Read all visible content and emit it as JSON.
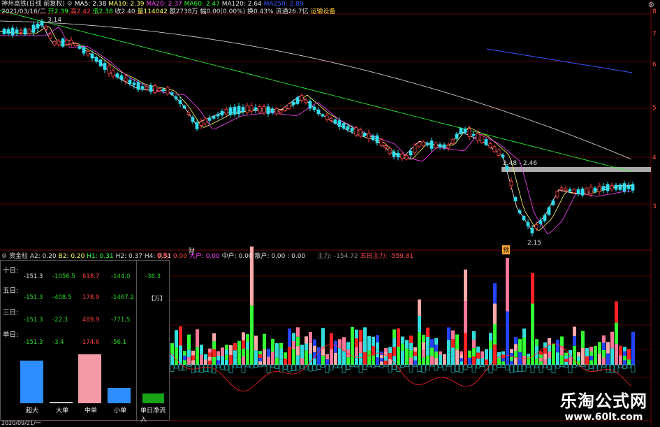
{
  "header": {
    "stock": "神州高铁(日线 前复权)",
    "ma5": "MA5: 2.38",
    "ma10": "MA10: 2.39",
    "ma20": "MA20: 2.37",
    "ma60": "MA60: 2.47",
    "ma120": "MA120: 2.64",
    "ma250": "MA250: 2.89",
    "date": "2021/03/16/二",
    "open": "开2.39",
    "high": "高2.42",
    "low": "低2.38",
    "close": "收2.40",
    "volume": "量114042",
    "amount": "额2738万",
    "change": "幅0.00(0.00%)",
    "turnover": "换0.43%",
    "float_cap": "流通26.7亿",
    "sector": "运输设备",
    "colors": {
      "ma5": "#ffffff",
      "ma10": "#ffff66",
      "ma20": "#ff44ff",
      "ma60": "#33ff33",
      "ma120": "#e0e0e0",
      "ma250": "#3a56ff"
    }
  },
  "main_chart": {
    "high_label": "3.14",
    "low_label": "2.15",
    "range_label": "2.48 - 2.46",
    "marker_cai": "财",
    "marker_yu": "预",
    "y_ticks": [
      "3",
      "4",
      "5",
      "6",
      "7",
      "8"
    ]
  },
  "indicator": {
    "name": "资金柱",
    "a2": "A2: 0.20",
    "b2": "B2: 0.20",
    "h1": "H1: 0.31",
    "h2": "H2: 0.37",
    "h4": "H4: 0.51",
    "jg": "机构: 0.00",
    "dh": "大户: 0.00",
    "zh": "中户: 0.00",
    "sh": "散户: 0.00",
    "dots": ": 0.00",
    "zl": "主力: -154.72",
    "wrzl": "五日主力: -559.81"
  },
  "panel": {
    "rows": [
      {
        "label": "十日:",
        "v": [
          "-151.3",
          "-1056.5",
          "618.7",
          "-144.0"
        ],
        "side": "-36.3"
      },
      {
        "label": "五日:",
        "v": [
          "-151.3",
          "-408.5",
          "178.9",
          "-1467.2"
        ],
        "side": "【万】"
      },
      {
        "label": "三日:",
        "v": [
          "-151.3",
          "-22.3",
          "489.9",
          "-771.5"
        ],
        "side": ""
      },
      {
        "label": "单日:",
        "v": [
          "-151.3",
          "-3.4",
          "174.6",
          "-56.1"
        ],
        "side": ""
      }
    ],
    "bars": [
      {
        "label": "超大",
        "value": -151.3,
        "color": "#2e8dff"
      },
      {
        "label": "大单",
        "value": -3.4,
        "color": "#cccccc"
      },
      {
        "label": "中单",
        "value": 174.6,
        "color": "#f49aa6"
      },
      {
        "label": "小单",
        "value": -56.1,
        "color": "#2e8dff"
      },
      {
        "label": "单日净流入",
        "value": -36.3,
        "color": "#17a217"
      }
    ]
  },
  "footer": {
    "date_left": "2020/09/21/一"
  },
  "watermark": {
    "line1": "乐淘公式网",
    "line2": "www.60lt.com"
  },
  "chart_data": [
    {
      "type": "candlestick",
      "title": "神州高铁(日线 前复权)",
      "moving_averages": [
        {
          "name": "MA5",
          "value": 2.38
        },
        {
          "name": "MA10",
          "value": 2.39
        },
        {
          "name": "MA20",
          "value": 2.37
        },
        {
          "name": "MA60",
          "value": 2.47
        },
        {
          "name": "MA120",
          "value": 2.64
        },
        {
          "name": "MA250",
          "value": 2.89
        }
      ],
      "last_bar": {
        "date": "2021/03/16",
        "open": 2.39,
        "high": 2.42,
        "low": 2.38,
        "close": 2.4,
        "volume": 114042
      },
      "annotations": [
        {
          "text": "3.14"
        },
        {
          "text": "2.15"
        },
        {
          "text": "2.48 - 2.46"
        }
      ]
    },
    {
      "type": "bar",
      "title": "资金柱",
      "categories": [
        "超大",
        "大单",
        "中单",
        "小单"
      ],
      "series": [
        {
          "name": "十日",
          "values": [
            -151.3,
            -1056.5,
            618.7,
            -144.0
          ]
        },
        {
          "name": "五日",
          "values": [
            -151.3,
            -408.5,
            178.9,
            -1467.2
          ]
        },
        {
          "name": "三日",
          "values": [
            -151.3,
            -22.3,
            489.9,
            -771.5
          ]
        },
        {
          "name": "单日",
          "values": [
            -151.3,
            -3.4,
            174.6,
            -56.1
          ]
        }
      ]
    }
  ]
}
